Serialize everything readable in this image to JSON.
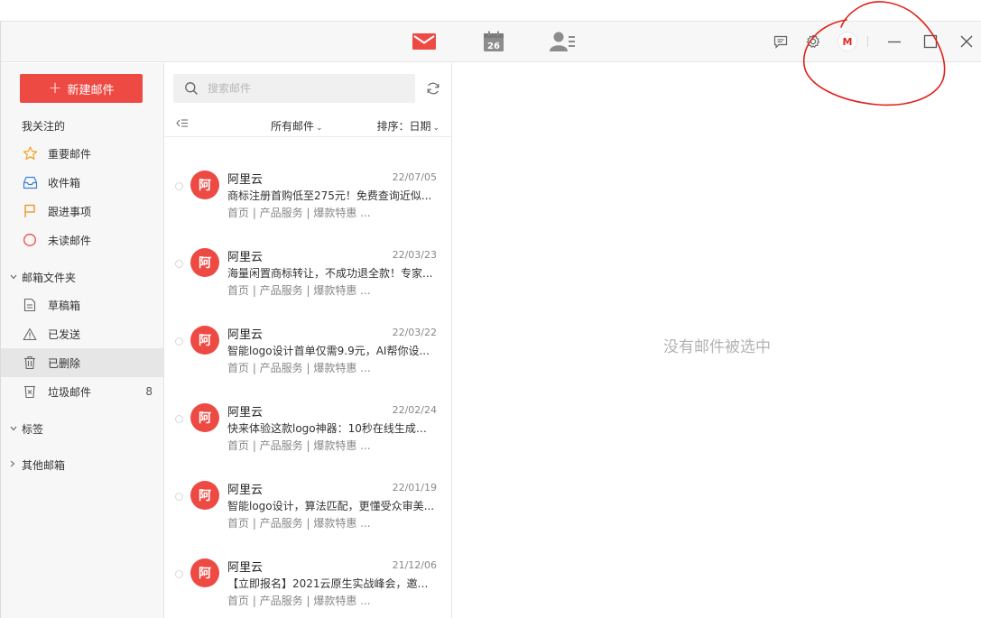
{
  "toolbar": {
    "nav": [
      "mail",
      "calendar",
      "contacts"
    ],
    "calendar_day": "26",
    "avatar_letter": "M"
  },
  "sidebar": {
    "compose_label": "新建邮件",
    "favorites_title": "我关注的",
    "favorites": [
      {
        "label": "重要邮件",
        "icon": "star-icon"
      },
      {
        "label": "收件箱",
        "icon": "inbox-icon"
      },
      {
        "label": "跟进事项",
        "icon": "flag-icon"
      },
      {
        "label": "未读邮件",
        "icon": "circle-icon"
      }
    ],
    "folders_title": "邮箱文件夹",
    "folders": [
      {
        "label": "草稿箱",
        "icon": "draft-icon",
        "count": ""
      },
      {
        "label": "已发送",
        "icon": "sent-icon",
        "count": ""
      },
      {
        "label": "已删除",
        "icon": "trash-icon",
        "count": ""
      },
      {
        "label": "垃圾邮件",
        "icon": "junk-icon",
        "count": "8"
      }
    ],
    "tags_title": "标签",
    "other_title": "其他邮箱"
  },
  "list": {
    "search_placeholder": "搜索邮件",
    "filter_label": "所有邮件",
    "sort_label": "排序：日期",
    "mails": [
      {
        "avatar": "阿",
        "sender": "阿里云",
        "date": "22/07/05",
        "subject": "商标注册首购低至275元！免费查询近似...",
        "snippet": "首页 | 产品服务 | 爆款特惠 ..."
      },
      {
        "avatar": "阿",
        "sender": "阿里云",
        "date": "22/03/23",
        "subject": "海量闲置商标转让，不成功退全款！专家...",
        "snippet": "首页 | 产品服务 | 爆款特惠 ..."
      },
      {
        "avatar": "阿",
        "sender": "阿里云",
        "date": "22/03/22",
        "subject": "智能logo设计首单仅需9.9元，AI帮你设...",
        "snippet": "首页 | 产品服务 | 爆款特惠 ..."
      },
      {
        "avatar": "阿",
        "sender": "阿里云",
        "date": "22/02/24",
        "subject": "快来体验这款logo神器：10秒在线生成，...",
        "snippet": "首页 | 产品服务 | 爆款特惠 ..."
      },
      {
        "avatar": "阿",
        "sender": "阿里云",
        "date": "22/01/19",
        "subject": "智能logo设计，算法匹配，更懂受众审美...",
        "snippet": "首页 | 产品服务 | 爆款特惠 ..."
      },
      {
        "avatar": "阿",
        "sender": "阿里云",
        "date": "21/12/06",
        "subject": "【立即报名】2021云原生实战峰会，邀您...",
        "snippet": "首页 | 产品服务 | 爆款特惠 ..."
      }
    ]
  },
  "reading": {
    "empty_message": "没有邮件被选中"
  },
  "colors": {
    "accent": "#ee4a44",
    "annotation": "#e0201a"
  }
}
